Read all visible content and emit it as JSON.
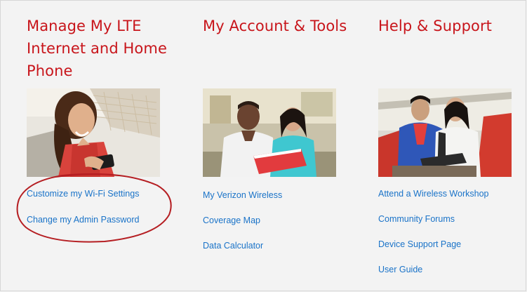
{
  "columns": [
    {
      "title": "Manage My LTE Internet and Home Phone",
      "photo_icon": "woman-with-phone-photo",
      "links": [
        "Customize my Wi-Fi Settings",
        "Change my Admin Password"
      ]
    },
    {
      "title": "My Account & Tools",
      "photo_icon": "people-with-tablet-photo",
      "links": [
        "My Verizon Wireless",
        "Coverage Map",
        "Data Calculator"
      ]
    },
    {
      "title": "Help & Support",
      "photo_icon": "workshop-people-photo",
      "links": [
        "Attend a Wireless Workshop",
        "Community Forums",
        "Device Support Page",
        "User Guide"
      ]
    }
  ],
  "colors": {
    "heading": "#c8151b",
    "link": "#1a73c8",
    "background": "#f3f3f3",
    "highlight": "#b51e22"
  }
}
